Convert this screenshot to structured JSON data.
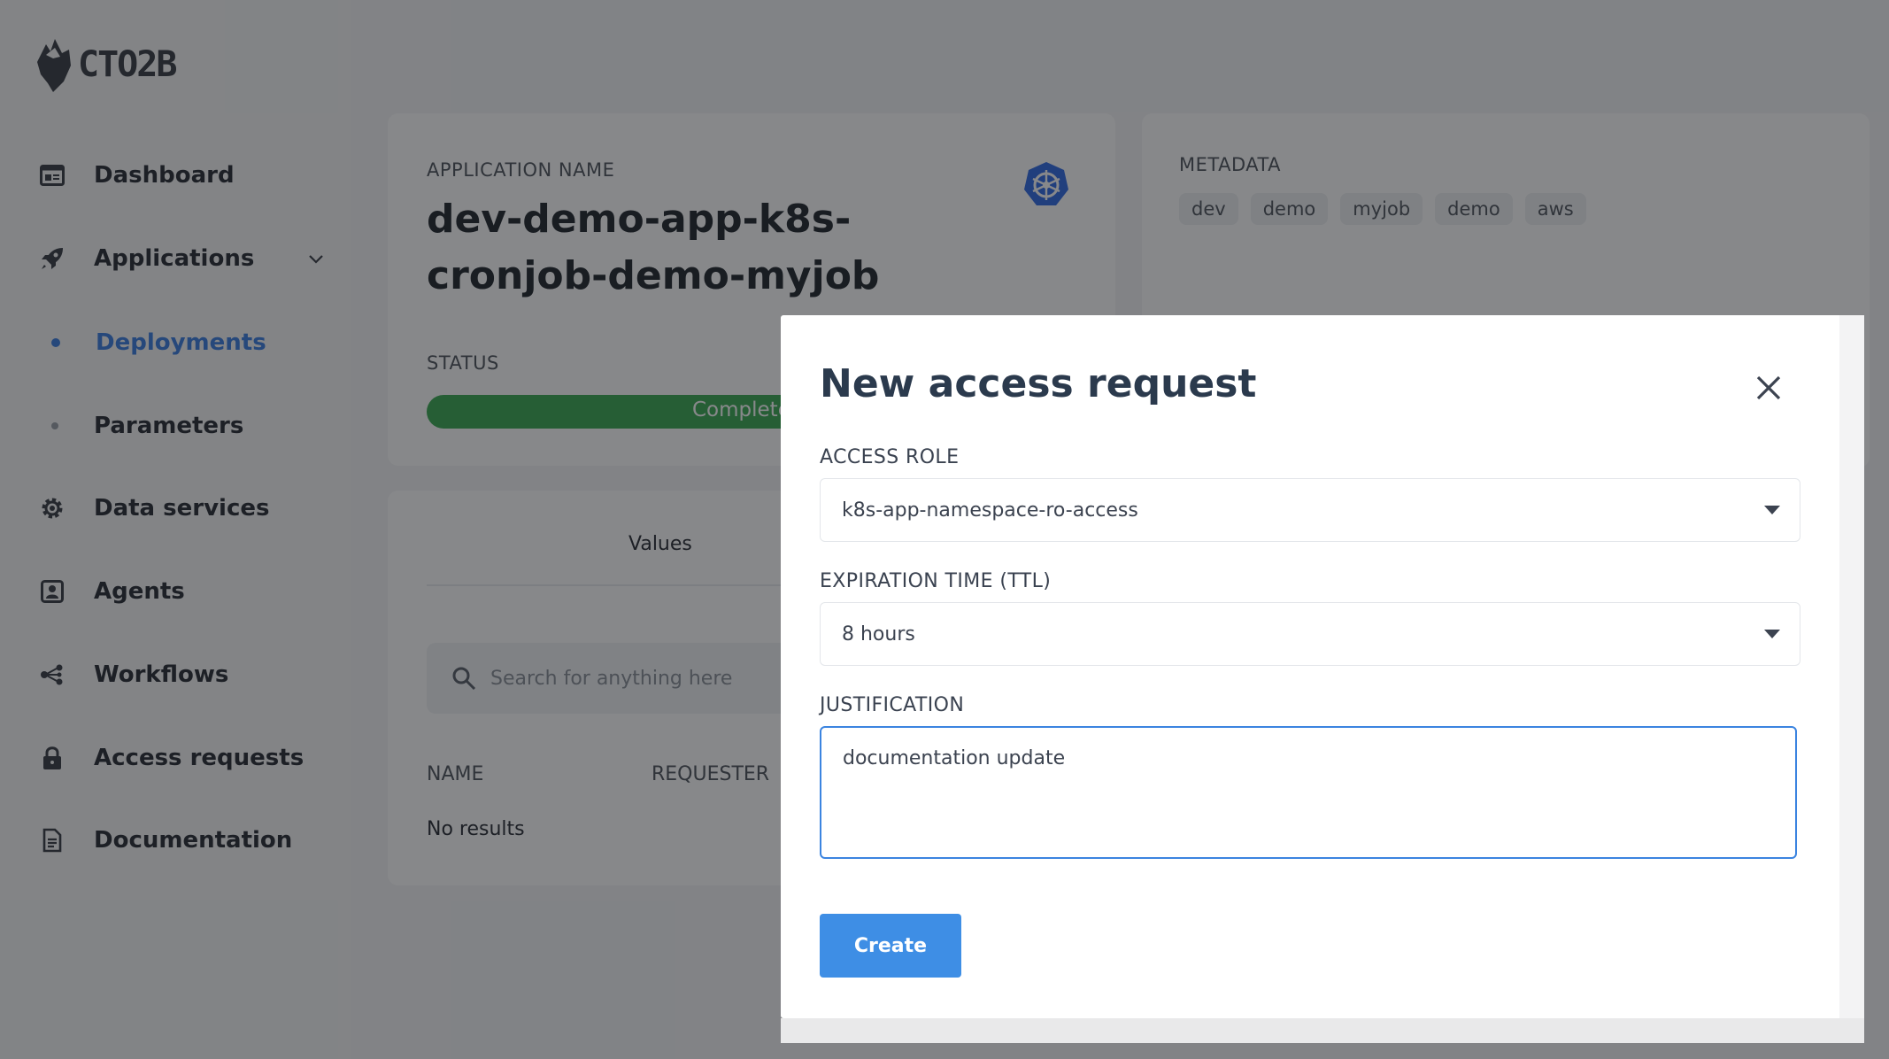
{
  "brand": {
    "logo_text": "CTO2B"
  },
  "sidebar": {
    "items": [
      {
        "label": "Dashboard",
        "icon": "dashboard-icon"
      },
      {
        "label": "Applications",
        "icon": "rocket-icon"
      },
      {
        "label": "Deployments",
        "active": true
      },
      {
        "label": "Parameters"
      },
      {
        "label": "Data services",
        "icon": "gear-icon"
      },
      {
        "label": "Agents",
        "icon": "user-badge-icon"
      },
      {
        "label": "Workflows",
        "icon": "workflow-icon"
      },
      {
        "label": "Access requests",
        "icon": "lock-icon"
      },
      {
        "label": "Documentation",
        "icon": "document-icon"
      }
    ]
  },
  "app_card": {
    "name_label": "APPLICATION NAME",
    "name": "dev-demo-app-k8s-cronjob-demo-myjob",
    "status_label": "STATUS",
    "status_text": "Completed",
    "status_color": "#3dab55"
  },
  "metadata_card": {
    "label": "METADATA",
    "tags": [
      "dev",
      "demo",
      "myjob",
      "demo",
      "aws"
    ]
  },
  "lower_card": {
    "tab_values": "Values",
    "search_placeholder": "Search for anything here",
    "columns": [
      "NAME",
      "REQUESTER"
    ],
    "empty_text": "No results"
  },
  "modal": {
    "title": "New access request",
    "access_role_label": "ACCESS ROLE",
    "access_role_value": "k8s-app-namespace-ro-access",
    "ttl_label": "EXPIRATION TIME (TTL)",
    "ttl_value": "8 hours",
    "justification_label": "JUSTIFICATION",
    "justification_value": "documentation update",
    "create_label": "Create"
  },
  "colors": {
    "accent": "#3e8ee5",
    "active_nav": "#3d7ee0",
    "focus_border": "#3b84e0"
  }
}
